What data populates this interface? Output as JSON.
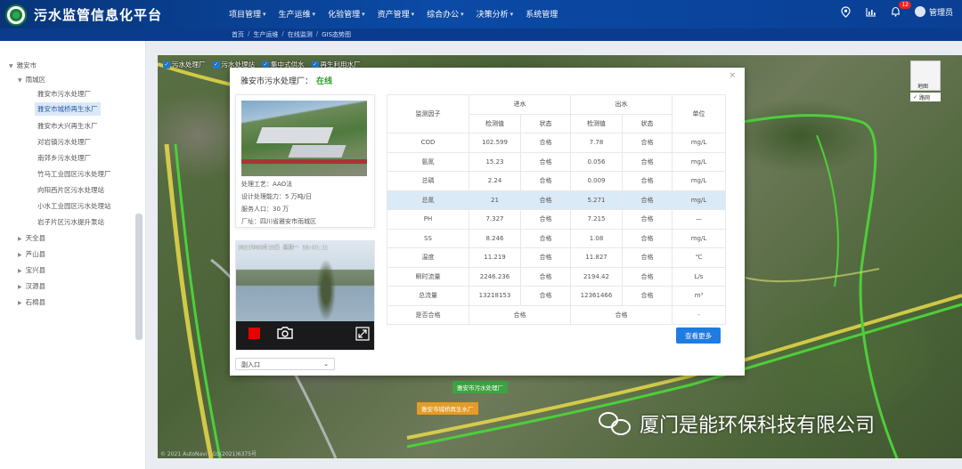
{
  "app": {
    "title": "污水监管信息化平台",
    "admin_label": "管理员",
    "notification_count": "12"
  },
  "nav": [
    "项目管理",
    "生产运维",
    "化验管理",
    "资产管理",
    "综合办公",
    "决策分析",
    "系统管理"
  ],
  "breadcrumb": [
    "首页",
    "生产运维",
    "在线监测",
    "GIS态势图"
  ],
  "sidebar": {
    "root": "雅安市",
    "district": "雨城区",
    "plants": [
      "雅安市污水处理厂",
      "雅安市城桥再生水厂",
      "雅安市大兴再生水厂",
      "对岩镇污水处理厂",
      "南郊乡污水处理厂",
      "竹马工业园区污水处理厂",
      "向阳西片区污水处理站",
      "小水工业园区污水处理站",
      "岩子片区污水提升泵站"
    ],
    "counties": [
      "天全县",
      "芦山县",
      "宝兴县",
      "汉源县",
      "石棉县"
    ]
  },
  "map": {
    "layers": [
      "污水处理厂",
      "污水处理站",
      "集中式供水",
      "再生利用水厂"
    ],
    "maptype_label": "地图",
    "road_label": "路网",
    "markers": [
      "雅安市污水处理厂",
      "雅安市城桥再生水厂"
    ],
    "watermark": "厦门是能环保科技有限公司",
    "attribution": "© 2021 AutoNavi - GS(2021)6375号"
  },
  "popup": {
    "title": "雅安市污水处理厂：",
    "status": "在线",
    "close": "×",
    "info": {
      "process": "处理工艺：AAO法",
      "capacity": "设计处理能力：5 万吨/日",
      "population": "服务人口：30 万",
      "address": "厂址：四川省雅安市雨城区"
    },
    "video_osd": "2021年03月15日 星期一 16:41:11",
    "select_value": "副入口",
    "table": {
      "factor_header": "监测因子",
      "inlet_header": "进水",
      "outlet_header": "出水",
      "unit_header": "单位",
      "value_header": "检测值",
      "status_header": "状态",
      "rows": [
        [
          "COD",
          "102.599",
          "合格",
          "7.78",
          "合格",
          "mg/L"
        ],
        [
          "氨氮",
          "15.23",
          "合格",
          "0.056",
          "合格",
          "mg/L"
        ],
        [
          "总磷",
          "2.24",
          "合格",
          "0.009",
          "合格",
          "mg/L"
        ],
        [
          "总氮",
          "21",
          "合格",
          "5.271",
          "合格",
          "mg/L"
        ],
        [
          "PH",
          "7.327",
          "合格",
          "7.215",
          "合格",
          "—"
        ],
        [
          "SS",
          "8.246",
          "合格",
          "1.08",
          "合格",
          "mg/L"
        ],
        [
          "温度",
          "11.219",
          "合格",
          "11.827",
          "合格",
          "℃"
        ],
        [
          "瞬时流量",
          "2246.236",
          "合格",
          "2194.42",
          "合格",
          "L/s"
        ],
        [
          "总流量",
          "13218153",
          "合格",
          "12361466",
          "合格",
          "m³"
        ]
      ],
      "overall_label": "是否合格",
      "overall_inlet": "合格",
      "overall_outlet": "合格",
      "overall_unit": "-"
    },
    "more_button": "查看更多"
  }
}
